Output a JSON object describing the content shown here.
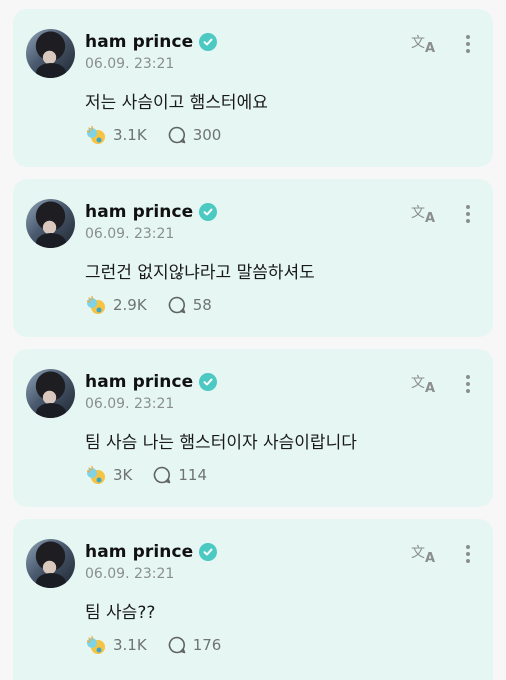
{
  "posts": [
    {
      "author": "ham prince",
      "timestamp": "06.09. 23:21",
      "text": "저는 사슴이고 햄스터에요",
      "reactions": "3.1K",
      "comments": "300"
    },
    {
      "author": "ham prince",
      "timestamp": "06.09. 23:21",
      "text": "그런건 없지않냐라고 말씀하셔도",
      "reactions": "2.9K",
      "comments": "58"
    },
    {
      "author": "ham prince",
      "timestamp": "06.09. 23:21",
      "text": "팀 사슴 나는 햄스터이자 사슴이랍니다",
      "reactions": "3K",
      "comments": "114"
    },
    {
      "author": "ham prince",
      "timestamp": "06.09. 23:21",
      "text": "팀 사슴??",
      "reactions": "3.1K",
      "comments": "176"
    }
  ],
  "icons": {
    "verified": "verified-badge-icon",
    "translate": "translate-icon",
    "more": "more-vertical-icon",
    "reaction": "reaction-emoji-icon",
    "comment": "comment-bubble-icon"
  },
  "colors": {
    "card_background": "#e6f7f3",
    "verified_badge": "#4cc9c2",
    "secondary_text": "#8a8f8d"
  }
}
